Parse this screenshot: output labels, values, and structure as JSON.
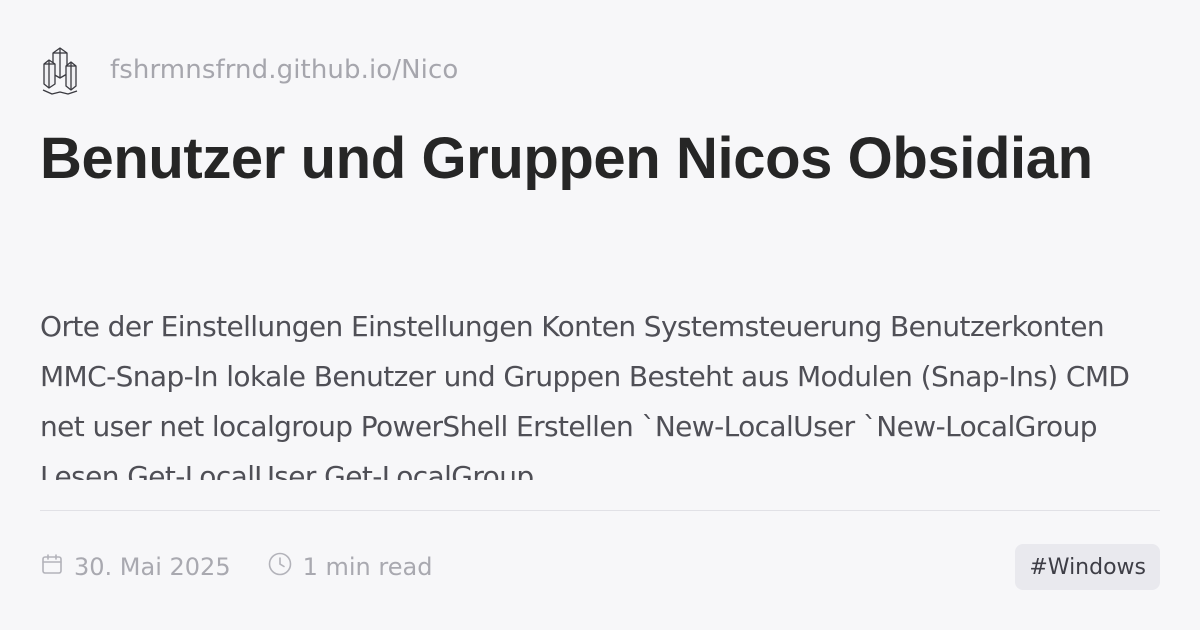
{
  "site": {
    "logo_icon": "crystal-icon",
    "url": "fshrmnsfrnd.github.io/Nico"
  },
  "post": {
    "title": "Benutzer und Gruppen Nicos Obsidian",
    "excerpt": "Orte der Einstellungen Einstellungen Konten Systemsteuerung Benutzerkonten MMC-Snap-In lokale Benutzer und Gruppen Besteht aus Modulen (Snap-Ins) CMD net user net localgroup PowerShell Erstellen `New-LocalUser `New-LocalGroup Lesen Get-LocalUser Get-LocalGroup"
  },
  "meta": {
    "date_icon": "calendar-icon",
    "date": "30. Mai 2025",
    "read_icon": "clock-icon",
    "read_time": "1 min read",
    "tag": "#Windows"
  },
  "colors": {
    "background": "#f7f7f9",
    "title": "#262626",
    "excerpt": "#4f4f56",
    "muted": "#a9a9b0",
    "tag_bg": "#e9e9ee"
  }
}
